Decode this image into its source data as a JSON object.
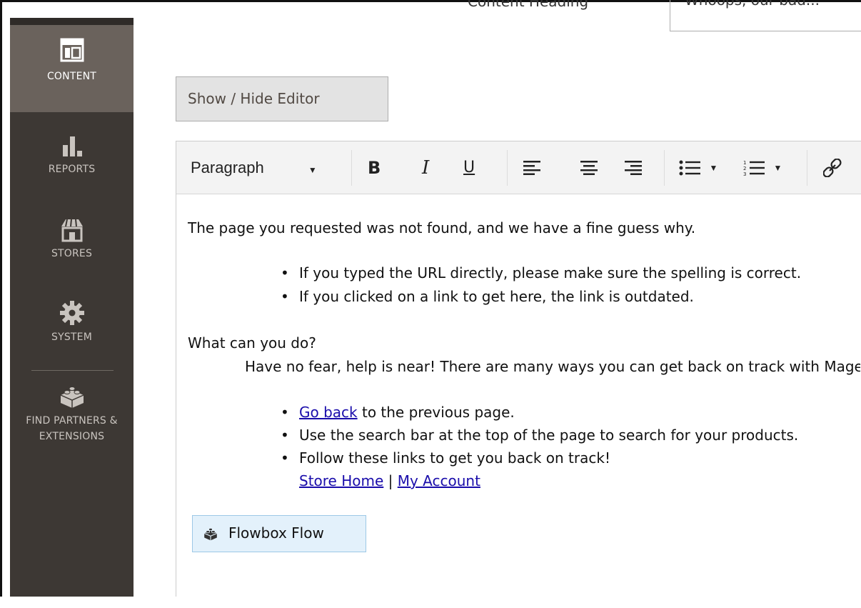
{
  "sidebar": {
    "items": [
      {
        "label": "CONTENT",
        "icon": "layout-icon",
        "active": true
      },
      {
        "label": "REPORTS",
        "icon": "bar-chart-icon"
      },
      {
        "label": "STORES",
        "icon": "storefront-icon"
      },
      {
        "label": "SYSTEM",
        "icon": "gear-icon"
      },
      {
        "label": "FIND PARTNERS & EXTENSIONS",
        "icon": "lego-brick-icon"
      }
    ]
  },
  "content_heading": {
    "label": "Content Heading",
    "value": "Whoops, our bad..."
  },
  "editor": {
    "toggle_label": "Show / Hide Editor",
    "format_select": "Paragraph",
    "toolbar": {
      "bold": "B",
      "italic": "I",
      "underline": "U"
    },
    "body": {
      "intro": "The page you requested was not found, and we have a fine guess why.",
      "reasons": [
        "If you typed the URL directly, please make sure the spelling is correct.",
        "If you clicked on a link to get here, the link is outdated."
      ],
      "question": "What can you do?",
      "help_text": "Have no fear, help is near! There are many ways you can get back on track with Magento Store.",
      "go_back_link": "Go back",
      "go_back_rest": " to the previous page.",
      "search_tip": "Use the search bar at the top of the page to search for your products.",
      "follow_tip": "Follow these links to get you back on track!",
      "store_home_link": "Store Home",
      "link_separator": " | ",
      "my_account_link": "My Account"
    },
    "widget_label": "Flowbox Flow"
  },
  "colors": {
    "sidebar_bg": "#3d3834",
    "sidebar_active": "#6a625c",
    "link": "#1a0dab",
    "widget_bg": "#e3f1fb"
  }
}
